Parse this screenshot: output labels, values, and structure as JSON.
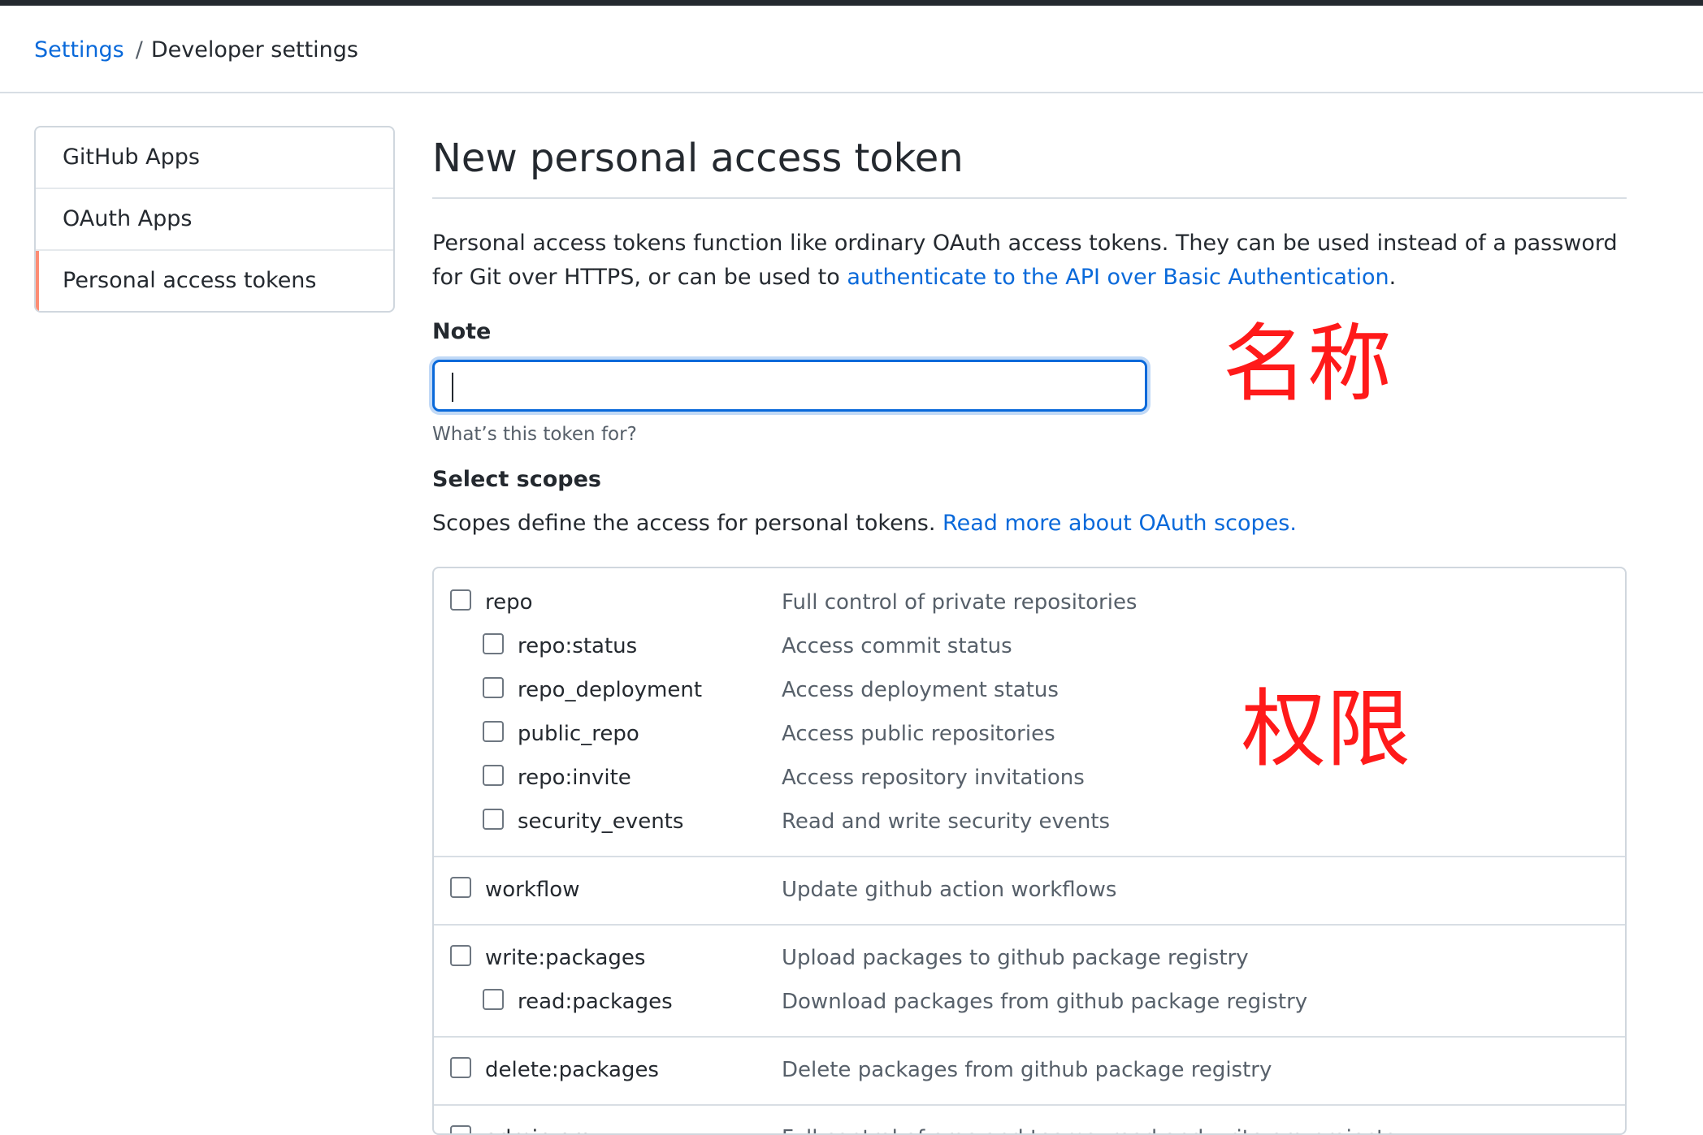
{
  "breadcrumb": {
    "root": "Settings",
    "separator": "/",
    "current": "Developer settings"
  },
  "sidebar": {
    "items": [
      {
        "label": "GitHub Apps",
        "selected": false
      },
      {
        "label": "OAuth Apps",
        "selected": false
      },
      {
        "label": "Personal access tokens",
        "selected": true
      }
    ]
  },
  "main": {
    "title": "New personal access token",
    "intro_text": "Personal access tokens function like ordinary OAuth access tokens. They can be used instead of a password for Git over HTTPS, or can be used to ",
    "intro_link": "authenticate to the API over Basic Authentication",
    "intro_end": ".",
    "note_label": "Note",
    "note_value": "",
    "note_hint": "What’s this token for?",
    "scopes_label": "Select scopes",
    "scopes_desc": "Scopes define the access for personal tokens. ",
    "scopes_link": "Read more about OAuth scopes."
  },
  "annotations": {
    "name": "名称",
    "permissions": "权限",
    "color": "#ff1a1a"
  },
  "scopes": {
    "repo": {
      "name": "repo",
      "desc": "Full control of private repositories"
    },
    "repo_status": {
      "name": "repo:status",
      "desc": "Access commit status"
    },
    "repo_deployment": {
      "name": "repo_deployment",
      "desc": "Access deployment status"
    },
    "public_repo": {
      "name": "public_repo",
      "desc": "Access public repositories"
    },
    "repo_invite": {
      "name": "repo:invite",
      "desc": "Access repository invitations"
    },
    "security_events": {
      "name": "security_events",
      "desc": "Read and write security events"
    },
    "workflow": {
      "name": "workflow",
      "desc": "Update github action workflows"
    },
    "write_packages": {
      "name": "write:packages",
      "desc": "Upload packages to github package registry"
    },
    "read_packages": {
      "name": "read:packages",
      "desc": "Download packages from github package registry"
    },
    "delete_packages": {
      "name": "delete:packages",
      "desc": "Delete packages from github package registry"
    },
    "admin_org": {
      "name": "admin:org",
      "desc": "Full control of orgs and teams, read and write org projects"
    }
  },
  "colors": {
    "link": "#0969da",
    "selected_accent": "#fd8c73",
    "focus_border": "#0969da"
  }
}
